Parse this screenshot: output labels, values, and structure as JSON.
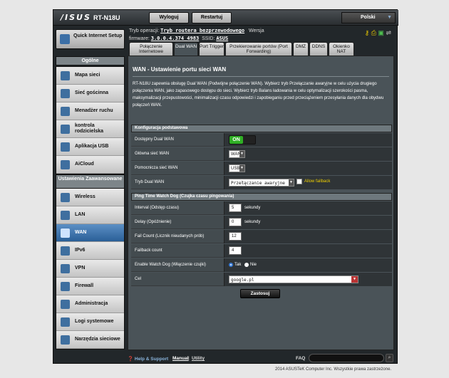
{
  "header": {
    "logo": "/ISUS",
    "model": "RT-N18U",
    "logout_label": "Wyloguj",
    "restart_label": "Restartuj",
    "language": "Polski"
  },
  "sidebar": {
    "quick_setup_label": "Quick Internet Setup",
    "general_title": "Ogólne",
    "general_items": [
      {
        "label": "Mapa sieci",
        "icon": "network-map-icon"
      },
      {
        "label": "Sieć gościnna",
        "icon": "guest-network-icon"
      },
      {
        "label": "Menadżer ruchu",
        "icon": "traffic-manager-icon"
      },
      {
        "label": "kontrola rodzicielska",
        "icon": "parental-control-icon"
      },
      {
        "label": "Aplikacja USB",
        "icon": "usb-app-icon"
      },
      {
        "label": "AiCloud",
        "icon": "cloud-icon"
      }
    ],
    "advanced_title": "Ustawienia Zaawansowane",
    "advanced_items": [
      {
        "label": "Wireless",
        "icon": "wireless-icon"
      },
      {
        "label": "LAN",
        "icon": "lan-icon"
      },
      {
        "label": "WAN",
        "icon": "wan-icon",
        "active": true
      },
      {
        "label": "IPv6",
        "icon": "ipv6-icon"
      },
      {
        "label": "VPN",
        "icon": "vpn-icon"
      },
      {
        "label": "Firewall",
        "icon": "firewall-icon"
      },
      {
        "label": "Administracja",
        "icon": "admin-icon"
      },
      {
        "label": "Logi systemowe",
        "icon": "system-log-icon"
      },
      {
        "label": "Narzędzia sieciowe",
        "icon": "network-tools-icon"
      }
    ]
  },
  "status": {
    "optype_label": "Tryb operacji:",
    "optype_value": "Tryb routera bezprzewodowego",
    "version_label": "Wersja",
    "firmware_label": "firmware:",
    "firmware_value": "3.0.0.4.374_4983",
    "ssid_label": "SSID:",
    "ssid_value": "ASUS"
  },
  "tabs": [
    {
      "label": "Połączenie Internetowe"
    },
    {
      "label": "Dual WAN",
      "active": true
    },
    {
      "label": "Port Trigger"
    },
    {
      "label": "Przekierowanie portów (Port Forwarding)"
    },
    {
      "label": "DMZ"
    },
    {
      "label": "DDNS"
    },
    {
      "label": "Okienko NAT"
    }
  ],
  "main": {
    "title": "WAN - Ustawienie portu sieci WAN",
    "description": "RT-N18U zapewnia obsługę Dual WAN (Podwójne połączenie WAN). Wybierz tryb Przełączanie awaryjne w celu użycia drugiego połączenia WAN, jako zapasowego dostępu do sieci. Wybierz tryb Balans ładowania w celu optymalizacji szerokości pasma, maksymalizacji przepustowości, minimalizacji czasu odpowiedzi i zapobieganiu przed przeciążeniem przesyłania danych dla obydwu połączeń WAN.",
    "basic_group": "Konfiguracja podstawowa",
    "dual_wan_label": "Dostępny Dual WAN",
    "dual_wan_state": "ON",
    "primary_wan_label": "Główna sieć WAN",
    "primary_wan_value": "WAN",
    "secondary_wan_label": "Pomocnicza sieć WAN",
    "secondary_wan_value": "USB",
    "dual_wan_mode_label": "Tryb Dual WAN",
    "dual_wan_mode_value": "Przełączanie awaryjne",
    "allow_failback_label": "Allow failback",
    "ping_group": "Ping Time Watch Dog (Czujka czasu pingowania)",
    "interval_label": "Interval (Odstęp czasu)",
    "interval_value": "5",
    "interval_unit": "sekundy",
    "delay_label": "Delay (Opóźnienie)",
    "delay_value": "0",
    "delay_unit": "sekundy",
    "fail_count_label": "Fail Count (Licznik nieudanych prób)",
    "fail_count_value": "12",
    "failback_label": "Failback count",
    "failback_value": "4",
    "watchdog_label": "Enable Watch Dog (Włączenie czujki)",
    "watchdog_yes": "Tak",
    "watchdog_no": "Nie",
    "target_label": "Cel",
    "target_value": "google.pl",
    "apply_label": "Zastosuj"
  },
  "footer": {
    "help_label": "Help & Support",
    "manual_label": "Manual",
    "separator": "|",
    "utility_label": "Utility",
    "faq_label": "FAQ",
    "copyright": "2014 ASUSTeK Computer Inc. Wszystkie prawa zastrzeżone."
  },
  "colors": {
    "accent": "#2a5f97",
    "toggle_on": "#2fae25",
    "status_icon": "#e8c800"
  }
}
